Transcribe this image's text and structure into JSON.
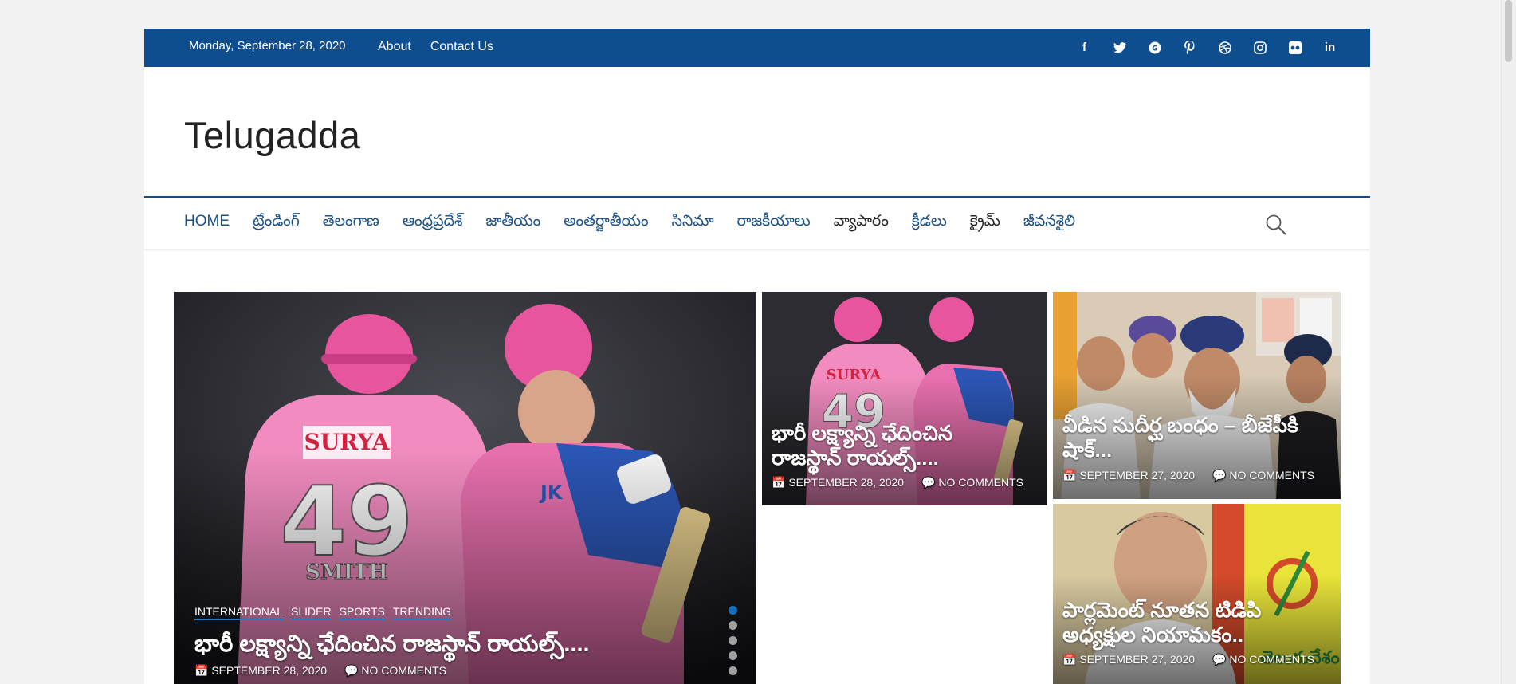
{
  "topbar": {
    "date": "Monday, September 28, 2020",
    "links": [
      "About",
      "Contact Us"
    ],
    "social": [
      "facebook-icon",
      "twitter-icon",
      "google-plus-icon",
      "pinterest-icon",
      "dribbble-icon",
      "instagram-icon",
      "flickr-icon",
      "linkedin-icon"
    ]
  },
  "site": {
    "title": "Telugadda"
  },
  "nav": {
    "items": [
      "HOME",
      "ట్రేండింగ్",
      "తెలంగాణ",
      "ఆంధ్రప్రదేశ్",
      "జాతీయం",
      "అంతర్జాతీయం",
      "సినిమా",
      "రాజకీయాలు",
      "వ్యాపారం",
      "క్రీడలు",
      "క్రైమ్",
      "జీవనశైలి"
    ]
  },
  "featured": {
    "categories": [
      "INTERNATIONAL",
      "SLIDER",
      "SPORTS",
      "TRENDING"
    ],
    "title": "భారీ లక్ష్యాన్ని ఛేదించిన రాజస్థాన్ రాయల్స్....",
    "date": "SEPTEMBER 28, 2020",
    "comments": "NO COMMENTS",
    "slides": 5,
    "active_slide": 1
  },
  "posts": [
    {
      "title": "భారీ లక్ష్యాన్ని ఛేదించిన రాజస్థాన్ రాయల్స్....",
      "date": "SEPTEMBER 28, 2020",
      "comments": "NO COMMENTS"
    },
    {
      "title": "వీడిన సుదీర్ఘ బంధం – బీజేపీకి షాక్...",
      "date": "SEPTEMBER 27, 2020",
      "comments": "NO COMMENTS"
    },
    {
      "title": "పార్లమెంట్ నూతన టిడిపి అధ్యక్షుల నియామకం..",
      "date": "SEPTEMBER 27, 2020",
      "comments": "NO COMMENTS"
    }
  ],
  "colors": {
    "brand": "#0e4e8e",
    "accent": "#1a7ed6",
    "page_bg": "#f2f2f2"
  }
}
